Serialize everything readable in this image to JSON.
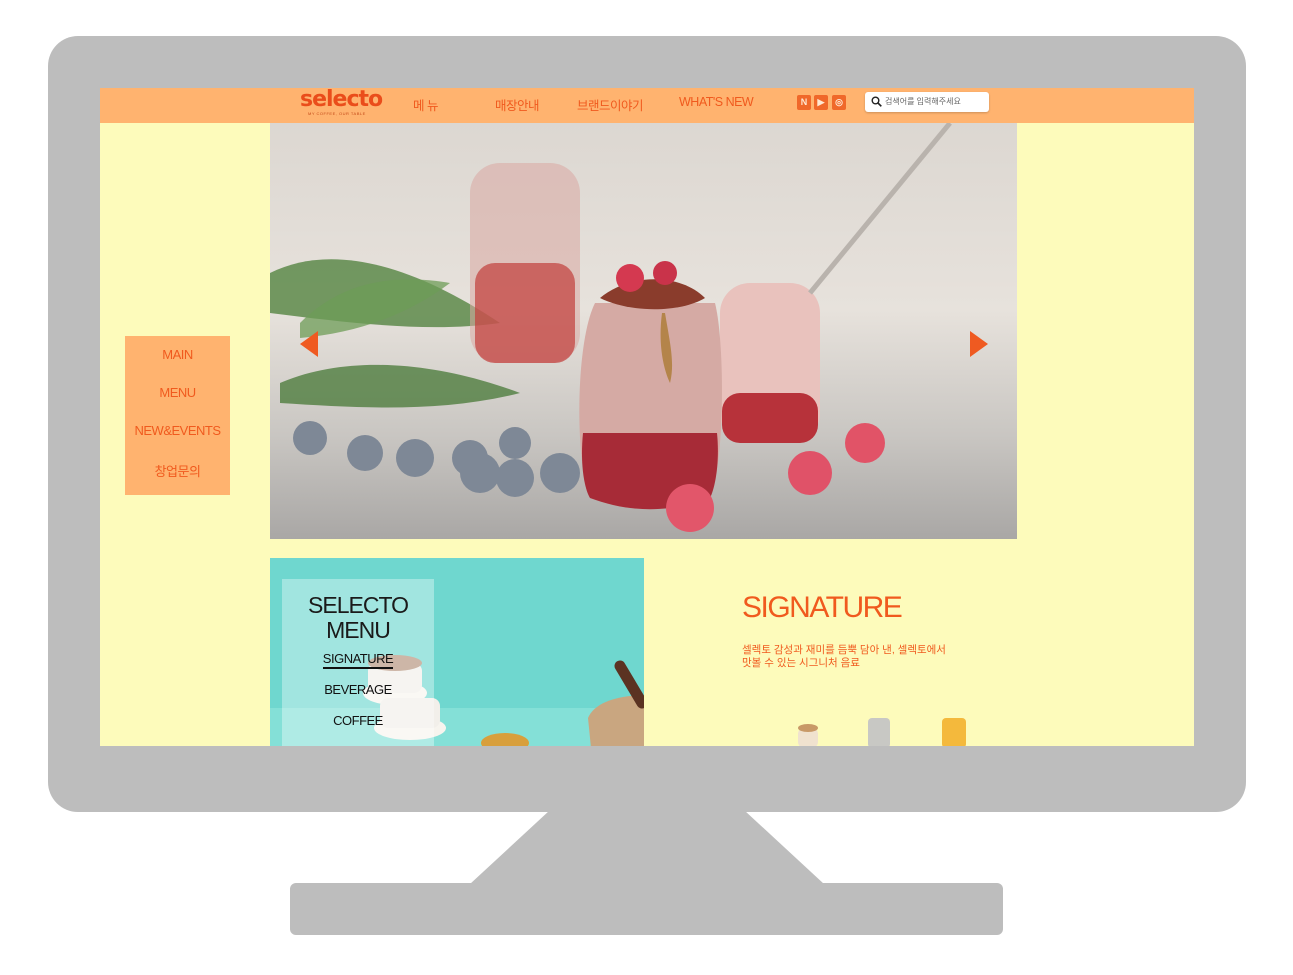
{
  "header": {
    "logo": "selecto",
    "logo_tagline": "MY COFFEE, OUR TABLE",
    "nav": [
      "메  뉴",
      "매장안내",
      "브랜드이야기",
      "WHAT'S NEW"
    ],
    "social": [
      {
        "icon": "naver-blog-icon",
        "glyph": "N"
      },
      {
        "icon": "youtube-icon",
        "glyph": "▶"
      },
      {
        "icon": "instagram-icon",
        "glyph": "◎"
      }
    ],
    "search_placeholder": "검색어를 입력해주세요"
  },
  "side_nav": [
    "MAIN",
    "MENU",
    "NEW&EVENTS",
    "창업문의"
  ],
  "hero": {
    "image": "smoothie-jars-with-berries",
    "prev_icon": "arrow-left-icon",
    "next_icon": "arrow-right-icon"
  },
  "menu_panel": {
    "title_line1": "SELECTO",
    "title_line2": "MENU",
    "links": [
      "SIGNATURE",
      "BEVERAGE",
      "COFFEE"
    ],
    "active": "SIGNATURE"
  },
  "signature": {
    "title": "SIGNATURE",
    "desc_line1": "셀렉토 감성과 재미를 듬뿍 담아 낸, 셀렉토에서",
    "desc_line2": "맛볼 수 있는 시그니처 음료"
  },
  "colors": {
    "header_bg": "#ffb36f",
    "accent": "#f05a1e",
    "page_bg": "#fdfbbb",
    "menu_bg": "#6fd7cf",
    "monitor": "#bdbdbd"
  }
}
